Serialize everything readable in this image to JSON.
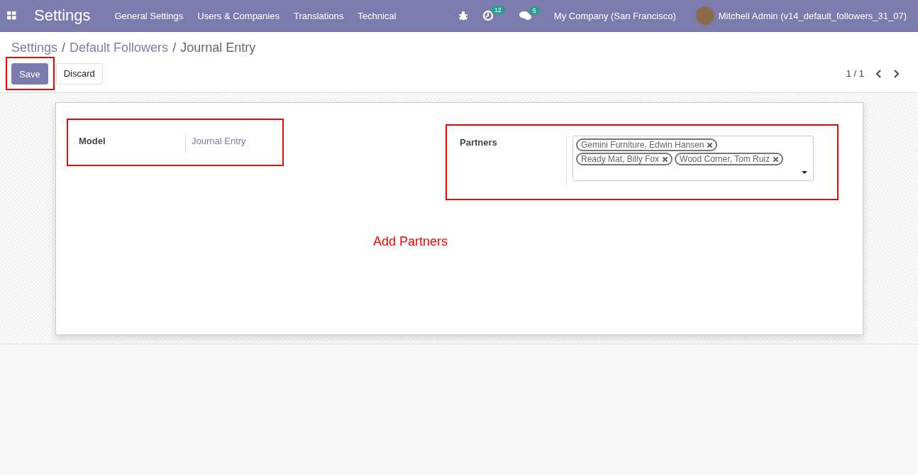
{
  "navbar": {
    "app_title": "Settings",
    "menu": [
      "General Settings",
      "Users & Companies",
      "Translations",
      "Technical"
    ],
    "activity_count": "12",
    "message_count": "5",
    "company": "My Company (San Francisco)",
    "user": "Mitchell Admin (v14_default_followers_31_07)"
  },
  "breadcrumb_separator": "/",
  "breadcrumbs": [
    {
      "label": "Settings",
      "current": false
    },
    {
      "label": "Default Followers",
      "current": false
    },
    {
      "label": "Journal Entry",
      "current": true
    }
  ],
  "buttons": [
    {
      "label": "Save",
      "kind": "primary",
      "highlighted": true
    },
    {
      "label": "Discard",
      "kind": "secondary",
      "highlighted": false
    }
  ],
  "pager": "1 / 1",
  "model_field": {
    "label": "Model",
    "value": "Journal Entry",
    "highlighted": true
  },
  "partners_field": {
    "label": "Partners",
    "highlighted": true,
    "tags": [
      "Gemini Furniture, Edwin Hansen",
      "Ready Mat, Billy Fox",
      "Wood Corner, Tom Ruiz"
    ]
  },
  "annotation": "Add Partners"
}
